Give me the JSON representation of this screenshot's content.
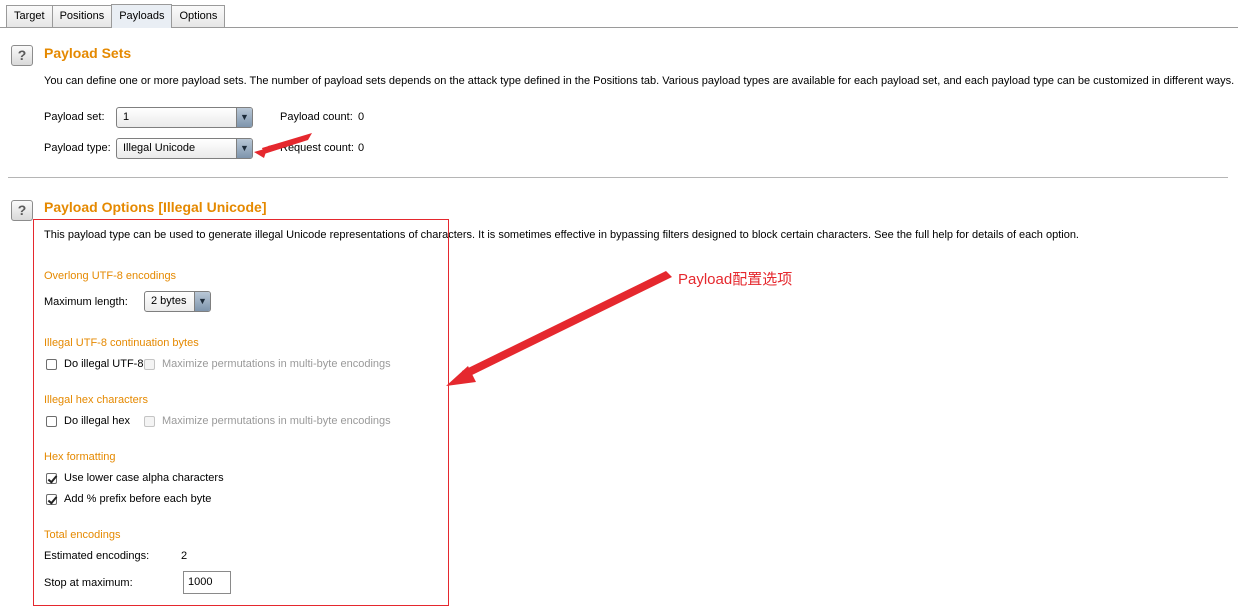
{
  "tabs": [
    {
      "label": "Target",
      "active": false
    },
    {
      "label": "Positions",
      "active": false
    },
    {
      "label": "Payloads",
      "active": true
    },
    {
      "label": "Options",
      "active": false
    }
  ],
  "payload_sets": {
    "help": "?",
    "title": "Payload Sets",
    "description": "You can define one or more payload sets. The number of payload sets depends on the attack type defined in the Positions tab. Various payload types are available for each payload set, and each payload type can be customized in different ways.",
    "payload_set_label": "Payload set:",
    "payload_set_value": "1",
    "payload_count_label": "Payload count:",
    "payload_count_value": "0",
    "payload_type_label": "Payload type:",
    "payload_type_value": "Illegal Unicode",
    "request_count_label": "Request count:",
    "request_count_value": "0"
  },
  "payload_options": {
    "help": "?",
    "title": "Payload Options [Illegal Unicode]",
    "description": "This payload type can be used to generate illegal Unicode representations of characters. It is sometimes effective in bypassing filters designed to block certain characters. See the full help for details of each option.",
    "overlong": {
      "heading": "Overlong UTF-8 encodings",
      "max_length_label": "Maximum length:",
      "max_length_value": "2 bytes"
    },
    "continuation": {
      "heading": "Illegal UTF-8 continuation bytes",
      "do_label": "Do illegal UTF-8",
      "do_checked": false,
      "maximize_label": "Maximize permutations in multi-byte encodings",
      "maximize_checked": false
    },
    "hex": {
      "heading": "Illegal hex characters",
      "do_label": "Do illegal hex",
      "do_checked": false,
      "maximize_label": "Maximize permutations in multi-byte encodings",
      "maximize_checked": false
    },
    "hex_formatting": {
      "heading": "Hex formatting",
      "lower_case_label": "Use lower case alpha characters",
      "lower_case_checked": true,
      "prefix_label": "Add % prefix before each byte",
      "prefix_checked": true
    },
    "total": {
      "heading": "Total encodings",
      "estimated_label": "Estimated encodings:",
      "estimated_value": "2",
      "stop_label": "Stop at maximum:",
      "stop_value": "1000"
    }
  },
  "annotation": {
    "text": "Payload配置选项",
    "color": "#e5282e"
  },
  "colors": {
    "accent": "#e58900",
    "annotation": "#e5282e"
  }
}
